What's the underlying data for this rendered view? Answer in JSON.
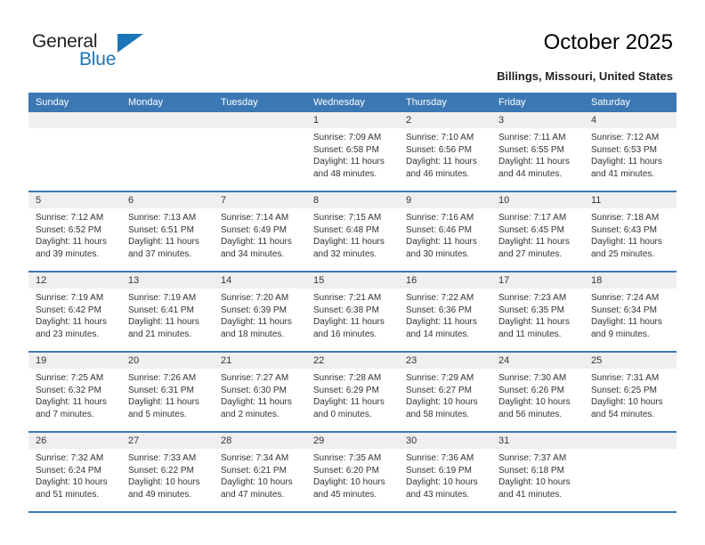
{
  "logo": {
    "word1": "General",
    "word2": "Blue",
    "triangle_color": "#1b75bb"
  },
  "header": {
    "title": "October 2025",
    "subtitle": "Billings, Missouri, United States"
  },
  "theme": {
    "header_blue": "#3c78b4",
    "daynum_gray": "#efefef",
    "text": "#333333"
  },
  "weekdays": [
    "Sunday",
    "Monday",
    "Tuesday",
    "Wednesday",
    "Thursday",
    "Friday",
    "Saturday"
  ],
  "weeks": [
    [
      {
        "day": "",
        "sunrise": "",
        "sunset": "",
        "daylight": "",
        "daylight2": "",
        "empty": true
      },
      {
        "day": "",
        "sunrise": "",
        "sunset": "",
        "daylight": "",
        "daylight2": "",
        "empty": true
      },
      {
        "day": "",
        "sunrise": "",
        "sunset": "",
        "daylight": "",
        "daylight2": "",
        "empty": true
      },
      {
        "day": "1",
        "sunrise": "Sunrise: 7:09 AM",
        "sunset": "Sunset: 6:58 PM",
        "daylight": "Daylight: 11 hours",
        "daylight2": "and 48 minutes."
      },
      {
        "day": "2",
        "sunrise": "Sunrise: 7:10 AM",
        "sunset": "Sunset: 6:56 PM",
        "daylight": "Daylight: 11 hours",
        "daylight2": "and 46 minutes."
      },
      {
        "day": "3",
        "sunrise": "Sunrise: 7:11 AM",
        "sunset": "Sunset: 6:55 PM",
        "daylight": "Daylight: 11 hours",
        "daylight2": "and 44 minutes."
      },
      {
        "day": "4",
        "sunrise": "Sunrise: 7:12 AM",
        "sunset": "Sunset: 6:53 PM",
        "daylight": "Daylight: 11 hours",
        "daylight2": "and 41 minutes."
      }
    ],
    [
      {
        "day": "5",
        "sunrise": "Sunrise: 7:12 AM",
        "sunset": "Sunset: 6:52 PM",
        "daylight": "Daylight: 11 hours",
        "daylight2": "and 39 minutes."
      },
      {
        "day": "6",
        "sunrise": "Sunrise: 7:13 AM",
        "sunset": "Sunset: 6:51 PM",
        "daylight": "Daylight: 11 hours",
        "daylight2": "and 37 minutes."
      },
      {
        "day": "7",
        "sunrise": "Sunrise: 7:14 AM",
        "sunset": "Sunset: 6:49 PM",
        "daylight": "Daylight: 11 hours",
        "daylight2": "and 34 minutes."
      },
      {
        "day": "8",
        "sunrise": "Sunrise: 7:15 AM",
        "sunset": "Sunset: 6:48 PM",
        "daylight": "Daylight: 11 hours",
        "daylight2": "and 32 minutes."
      },
      {
        "day": "9",
        "sunrise": "Sunrise: 7:16 AM",
        "sunset": "Sunset: 6:46 PM",
        "daylight": "Daylight: 11 hours",
        "daylight2": "and 30 minutes."
      },
      {
        "day": "10",
        "sunrise": "Sunrise: 7:17 AM",
        "sunset": "Sunset: 6:45 PM",
        "daylight": "Daylight: 11 hours",
        "daylight2": "and 27 minutes."
      },
      {
        "day": "11",
        "sunrise": "Sunrise: 7:18 AM",
        "sunset": "Sunset: 6:43 PM",
        "daylight": "Daylight: 11 hours",
        "daylight2": "and 25 minutes."
      }
    ],
    [
      {
        "day": "12",
        "sunrise": "Sunrise: 7:19 AM",
        "sunset": "Sunset: 6:42 PM",
        "daylight": "Daylight: 11 hours",
        "daylight2": "and 23 minutes."
      },
      {
        "day": "13",
        "sunrise": "Sunrise: 7:19 AM",
        "sunset": "Sunset: 6:41 PM",
        "daylight": "Daylight: 11 hours",
        "daylight2": "and 21 minutes."
      },
      {
        "day": "14",
        "sunrise": "Sunrise: 7:20 AM",
        "sunset": "Sunset: 6:39 PM",
        "daylight": "Daylight: 11 hours",
        "daylight2": "and 18 minutes."
      },
      {
        "day": "15",
        "sunrise": "Sunrise: 7:21 AM",
        "sunset": "Sunset: 6:38 PM",
        "daylight": "Daylight: 11 hours",
        "daylight2": "and 16 minutes."
      },
      {
        "day": "16",
        "sunrise": "Sunrise: 7:22 AM",
        "sunset": "Sunset: 6:36 PM",
        "daylight": "Daylight: 11 hours",
        "daylight2": "and 14 minutes."
      },
      {
        "day": "17",
        "sunrise": "Sunrise: 7:23 AM",
        "sunset": "Sunset: 6:35 PM",
        "daylight": "Daylight: 11 hours",
        "daylight2": "and 11 minutes."
      },
      {
        "day": "18",
        "sunrise": "Sunrise: 7:24 AM",
        "sunset": "Sunset: 6:34 PM",
        "daylight": "Daylight: 11 hours",
        "daylight2": "and 9 minutes."
      }
    ],
    [
      {
        "day": "19",
        "sunrise": "Sunrise: 7:25 AM",
        "sunset": "Sunset: 6:32 PM",
        "daylight": "Daylight: 11 hours",
        "daylight2": "and 7 minutes."
      },
      {
        "day": "20",
        "sunrise": "Sunrise: 7:26 AM",
        "sunset": "Sunset: 6:31 PM",
        "daylight": "Daylight: 11 hours",
        "daylight2": "and 5 minutes."
      },
      {
        "day": "21",
        "sunrise": "Sunrise: 7:27 AM",
        "sunset": "Sunset: 6:30 PM",
        "daylight": "Daylight: 11 hours",
        "daylight2": "and 2 minutes."
      },
      {
        "day": "22",
        "sunrise": "Sunrise: 7:28 AM",
        "sunset": "Sunset: 6:29 PM",
        "daylight": "Daylight: 11 hours",
        "daylight2": "and 0 minutes."
      },
      {
        "day": "23",
        "sunrise": "Sunrise: 7:29 AM",
        "sunset": "Sunset: 6:27 PM",
        "daylight": "Daylight: 10 hours",
        "daylight2": "and 58 minutes."
      },
      {
        "day": "24",
        "sunrise": "Sunrise: 7:30 AM",
        "sunset": "Sunset: 6:26 PM",
        "daylight": "Daylight: 10 hours",
        "daylight2": "and 56 minutes."
      },
      {
        "day": "25",
        "sunrise": "Sunrise: 7:31 AM",
        "sunset": "Sunset: 6:25 PM",
        "daylight": "Daylight: 10 hours",
        "daylight2": "and 54 minutes."
      }
    ],
    [
      {
        "day": "26",
        "sunrise": "Sunrise: 7:32 AM",
        "sunset": "Sunset: 6:24 PM",
        "daylight": "Daylight: 10 hours",
        "daylight2": "and 51 minutes."
      },
      {
        "day": "27",
        "sunrise": "Sunrise: 7:33 AM",
        "sunset": "Sunset: 6:22 PM",
        "daylight": "Daylight: 10 hours",
        "daylight2": "and 49 minutes."
      },
      {
        "day": "28",
        "sunrise": "Sunrise: 7:34 AM",
        "sunset": "Sunset: 6:21 PM",
        "daylight": "Daylight: 10 hours",
        "daylight2": "and 47 minutes."
      },
      {
        "day": "29",
        "sunrise": "Sunrise: 7:35 AM",
        "sunset": "Sunset: 6:20 PM",
        "daylight": "Daylight: 10 hours",
        "daylight2": "and 45 minutes."
      },
      {
        "day": "30",
        "sunrise": "Sunrise: 7:36 AM",
        "sunset": "Sunset: 6:19 PM",
        "daylight": "Daylight: 10 hours",
        "daylight2": "and 43 minutes."
      },
      {
        "day": "31",
        "sunrise": "Sunrise: 7:37 AM",
        "sunset": "Sunset: 6:18 PM",
        "daylight": "Daylight: 10 hours",
        "daylight2": "and 41 minutes."
      },
      {
        "day": "",
        "sunrise": "",
        "sunset": "",
        "daylight": "",
        "daylight2": "",
        "empty": true
      }
    ]
  ]
}
